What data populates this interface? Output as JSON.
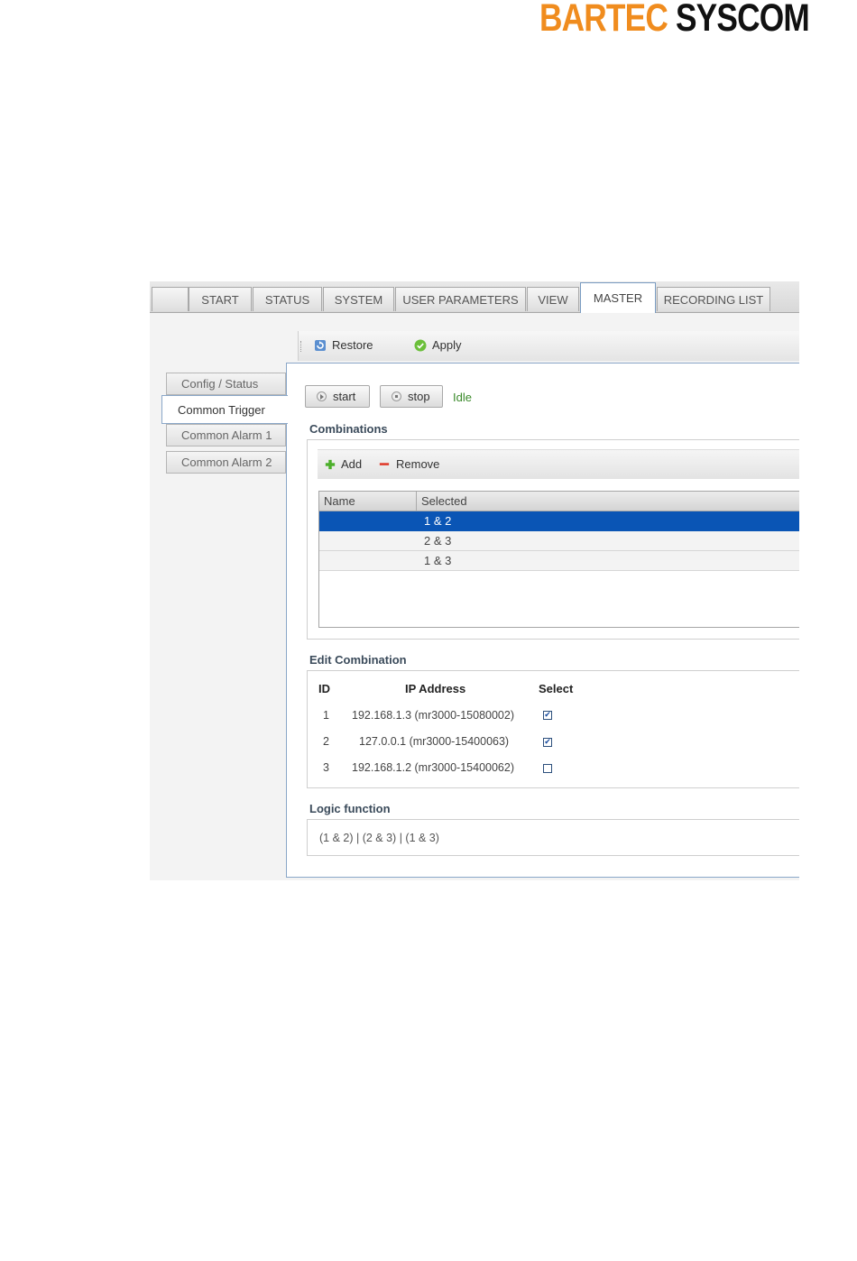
{
  "brand": {
    "part1": "BARTEC",
    "part2": "SYSCOM"
  },
  "tabs": [
    {
      "label": ""
    },
    {
      "label": "START"
    },
    {
      "label": "STATUS"
    },
    {
      "label": "SYSTEM"
    },
    {
      "label": "USER PARAMETERS"
    },
    {
      "label": "VIEW"
    },
    {
      "label": "MASTER",
      "active": true
    },
    {
      "label": "RECORDING LIST"
    }
  ],
  "subnav": [
    {
      "label": "Config / Status"
    },
    {
      "label": "Common Trigger",
      "active": true
    },
    {
      "label": "Common Alarm 1"
    },
    {
      "label": "Common Alarm 2"
    }
  ],
  "toolbar": {
    "restore": "Restore",
    "apply": "Apply"
  },
  "controls": {
    "start": "start",
    "stop": "stop",
    "status": "Idle"
  },
  "combinations": {
    "title": "Combinations",
    "add": "Add",
    "remove": "Remove",
    "columns": [
      "Name",
      "Selected"
    ],
    "rows": [
      {
        "name": "",
        "selected": "1 & 2",
        "highlighted": true
      },
      {
        "name": "",
        "selected": "2 & 3"
      },
      {
        "name": "",
        "selected": "1 & 3"
      }
    ]
  },
  "edit_combination": {
    "title": "Edit Combination",
    "columns": {
      "id": "ID",
      "ip": "IP Address",
      "select": "Select"
    },
    "rows": [
      {
        "id": "1",
        "ip": "192.168.1.3 (mr3000-15080002)",
        "checked": true
      },
      {
        "id": "2",
        "ip": "127.0.0.1 (mr3000-15400063)",
        "checked": true
      },
      {
        "id": "3",
        "ip": "192.168.1.2 (mr3000-15400062)",
        "checked": false
      }
    ]
  },
  "logic_function": {
    "title": "Logic function",
    "value": "(1 & 2) | (2 & 3) | (1 & 3)"
  },
  "colors": {
    "brand_orange": "#f08c1e",
    "selection_blue": "#0a55b5",
    "status_green": "#3a8a2a"
  }
}
